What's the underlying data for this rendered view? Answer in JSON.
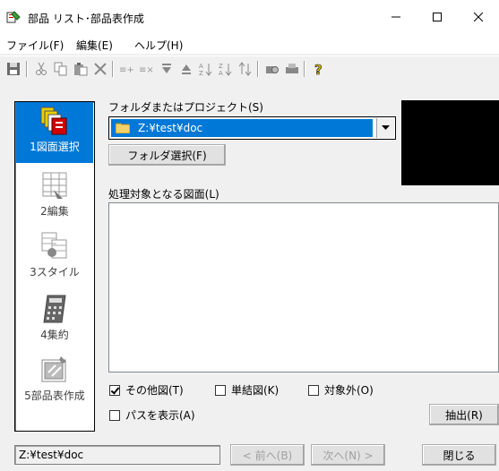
{
  "window": {
    "title": "部品 リスト･部品表作成"
  },
  "menu": {
    "items": [
      "ファイル(F)",
      "編集(E)",
      "ヘルプ(H)"
    ]
  },
  "toolbar": {
    "buttons": [
      "save-icon",
      "cut-icon",
      "copy-icon",
      "paste-icon",
      "delete-icon",
      "insert-row-icon",
      "delete-row-icon",
      "move-down-icon",
      "move-up-icon",
      "sort-ascending-icon",
      "sort-descending-icon",
      "sort-custom-icon",
      "print-preview-icon",
      "print-icon",
      "help-icon"
    ]
  },
  "nav": {
    "items": [
      {
        "label": "1図面選択",
        "icon": "drawings-icon",
        "active": true
      },
      {
        "label": "2編集",
        "icon": "edit-table-icon",
        "active": false
      },
      {
        "label": "3スタイル",
        "icon": "style-icon",
        "active": false
      },
      {
        "label": "4集約",
        "icon": "calculator-icon",
        "active": false
      },
      {
        "label": "5部品表作成",
        "icon": "parts-list-icon",
        "active": false
      }
    ]
  },
  "main": {
    "folder_label": "フォルダまたはプロジェクト(S)",
    "folder_value": "Z:¥test¥doc",
    "folder_select_button": "フォルダ選択(F)",
    "drawings_label": "処理対象となる図面(L)",
    "checkboxes": [
      {
        "label": "その他図(T)",
        "checked": true
      },
      {
        "label": "単結図(K)",
        "checked": false
      },
      {
        "label": "対象外(O)",
        "checked": false
      },
      {
        "label": "パスを表示(A)",
        "checked": false
      }
    ],
    "extract_button": "抽出(R)"
  },
  "footer": {
    "status": "Z:¥test¥doc",
    "prev_button": "< 前へ(B)",
    "next_button": "次へ(N) >",
    "close_button": "閉じる"
  },
  "colors": {
    "selection": "#0078d7",
    "preview_bg": "#000000"
  }
}
